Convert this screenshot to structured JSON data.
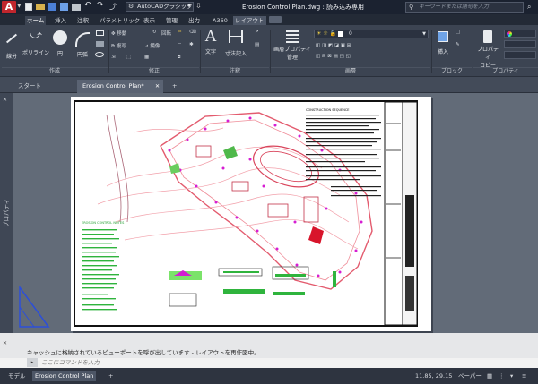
{
  "app": {
    "logo": "A",
    "workspace": "AutoCADクラシック",
    "title": "Erosion Control Plan.dwg : 読み込み専用",
    "search_placeholder": "キーワードまたは語句を入力",
    "colors": {
      "accent": "#c0262d",
      "ribbon": "#3c4452",
      "canvas": "#626b78"
    }
  },
  "ribbon_tabs": [
    "ホーム",
    "挿入",
    "注釈",
    "パラメトリック",
    "表示",
    "管理",
    "出力",
    "A360",
    "レイアウト"
  ],
  "ribbon_active": "ホーム",
  "ribbon": {
    "draw": {
      "line": "線分",
      "polyline": "ポリライン",
      "circle": "円",
      "arc": "円弧",
      "group": "作成"
    },
    "modify": {
      "move": "移動",
      "rotate": "回転",
      "trim": "トリム",
      "copy": "複写",
      "mirror": "鏡像",
      "fillet": "フィレット",
      "stretch": "ストレッチ",
      "scale": "尺度変更",
      "array": "配列複写",
      "group": "修正"
    },
    "annotation": {
      "text": "文字",
      "dimension": "寸法記入",
      "group": "注釈"
    },
    "layers": {
      "layer_props_1": "画層プロパティ",
      "layer_props_2": "管理",
      "layer_value": "0",
      "group": "画層"
    },
    "block": {
      "insert": "挿入",
      "group": "ブロック"
    },
    "properties": {
      "copy_1": "プロパティ",
      "copy_2": "コピー",
      "group": "プロパティ"
    }
  },
  "doc_tabs": {
    "start": "スタート",
    "active": "Erosion Control Plan*",
    "add": "+"
  },
  "palette_label": "プロパティ",
  "sheet": {
    "notes_title": "CONSTRUCTION SEQUENCE",
    "legend_title": "EROSION CONTROL NOTES"
  },
  "command": {
    "history": "キャッシュに格納されているビューポートを呼び出しています - レイアウトを再作図中。",
    "placeholder": "ここにコマンドを入力"
  },
  "status": {
    "model_tab": "モデル",
    "layout_tab": "Erosion Control Plan",
    "add": "+",
    "coords": "11.85, 29.15",
    "paper": "ペーパー"
  }
}
